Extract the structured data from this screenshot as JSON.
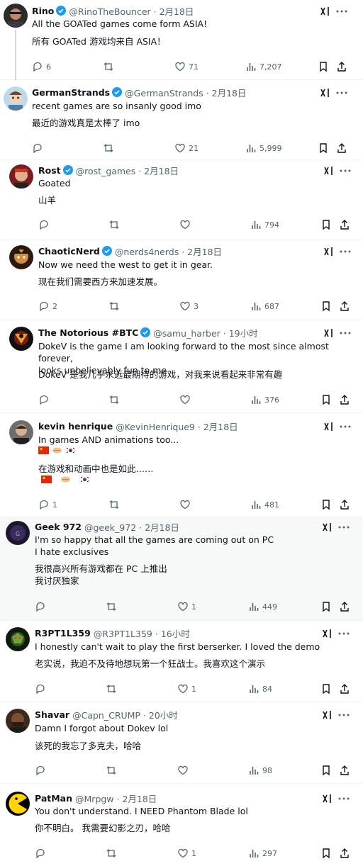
{
  "icons": {
    "reply": "reply-icon",
    "retweet": "retweet-icon",
    "like": "heart-icon",
    "views": "views-icon",
    "bookmark": "bookmark-icon",
    "share": "share-icon",
    "grok": "grok-icon",
    "more": "more-icon",
    "verified": "verified-badge-icon"
  },
  "colors": {
    "verified": "#1d9bf0",
    "muted": "#536471",
    "text": "#0f1419"
  },
  "tweets": [
    {
      "name": "Rino",
      "handle": "@RinoTheBouncer · 2月18日",
      "text": "All the GOATed games come form ASIA!",
      "translation": "所有 GOATed 游戏均来自 ASIA！",
      "replies": "6",
      "retweets": "",
      "likes": "71",
      "views": "7,207"
    },
    {
      "name": "GermanStrands",
      "handle": "@GermanStrands · 2月18日",
      "text": "recent games are so insanly good imo",
      "translation": "最近的游戏真是太棒了 imo",
      "replies": "",
      "retweets": "",
      "likes": "21",
      "views": "5,999"
    },
    {
      "name": "Rost",
      "handle": "@rost_games · 2月18日",
      "text": "Goated",
      "translation": "山羊",
      "replies": "",
      "retweets": "",
      "likes": "",
      "views": "794"
    },
    {
      "name": "ChaoticNerd",
      "handle": "@nerds4nerds · 2月18日",
      "text": "Now we need the west to get it in gear.",
      "translation": "现在我们需要西方来加速发展。",
      "replies": "2",
      "retweets": "",
      "likes": "3",
      "views": "687"
    },
    {
      "name": "The Notorious #BTC",
      "handle": "@samu_harber · 19小时",
      "text": "DokeV is the game I am looking forward to the most since almost forever,\nlooks unbelievably fun to me",
      "translation": "DokeV 是我几乎永远最期待的游戏，对我来说看起来非常有趣",
      "replies": "",
      "retweets": "",
      "likes": "",
      "views": "376"
    },
    {
      "name": "kevin henrique",
      "handle": "@KevinHenrique9 · 2月18日",
      "text": "In games AND animations too...",
      "translation": "在游戏和动画中也是如此……",
      "replies": "1",
      "retweets": "",
      "likes": "",
      "views": "481"
    },
    {
      "name": "Geek 972",
      "handle": "@geek_972 · 2月18日",
      "text": "I'm so happy that all the games are coming out on PC\nI hate exclusives",
      "translation": "我很高兴所有游戏都在 PC 上推出\n我讨厌独家",
      "replies": "",
      "retweets": "",
      "likes": "1",
      "views": "449"
    },
    {
      "name": "R3PT1L359",
      "handle": "@R3PT1L359 · 16小时",
      "text": "I honestly can't wait to play the first berserker. I loved the demo",
      "translation": "老实说，我迫不及待地想玩第一个狂战士。我喜欢这个演示",
      "replies": "",
      "retweets": "",
      "likes": "1",
      "views": "84"
    },
    {
      "name": "Shavar",
      "handle": "@Capn_CRUMP · 20小时",
      "text": "Damn I forgot about Dokev lol",
      "translation": "该死的我忘了多克夫，哈哈",
      "replies": "",
      "retweets": "",
      "likes": "",
      "views": "98"
    },
    {
      "name": "PatMan",
      "handle": "@Mrpgw · 2月18日",
      "text": "You don't understand. I NEED Phantom Blade lol",
      "translation": "你不明白。 我需要幻影之刃，哈哈",
      "replies": "",
      "retweets": "",
      "likes": "1",
      "views": "297"
    }
  ]
}
